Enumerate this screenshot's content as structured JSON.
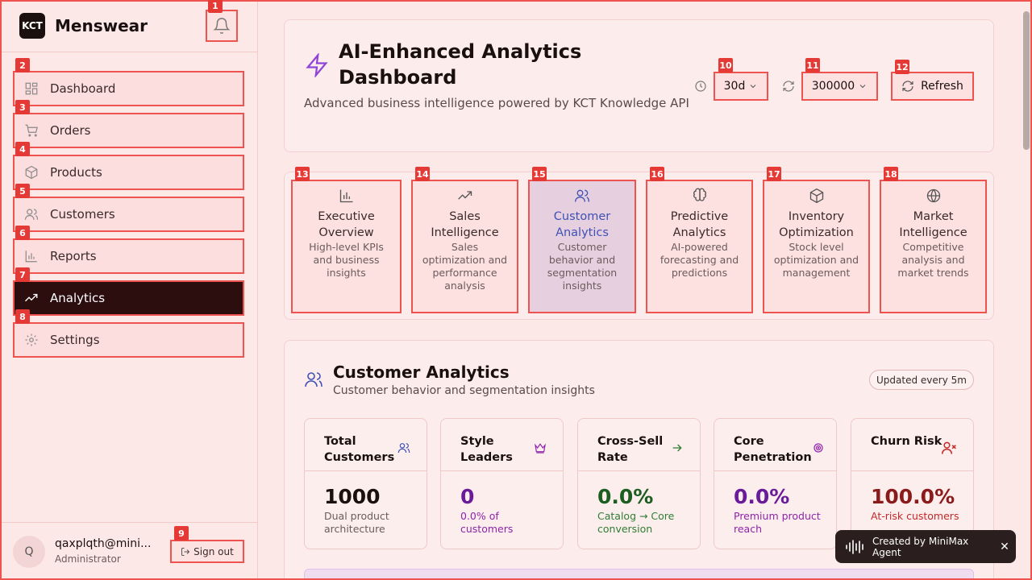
{
  "brand": {
    "logo": "KCT",
    "name": "Menswear"
  },
  "sidebar": {
    "items": [
      {
        "label": "Dashboard",
        "icon": "dashboard-icon",
        "badge": "2"
      },
      {
        "label": "Orders",
        "icon": "cart-icon",
        "badge": "3"
      },
      {
        "label": "Products",
        "icon": "box-icon",
        "badge": "4"
      },
      {
        "label": "Customers",
        "icon": "users-icon",
        "badge": "5"
      },
      {
        "label": "Reports",
        "icon": "bar-chart-icon",
        "badge": "6"
      },
      {
        "label": "Analytics",
        "icon": "trending-icon",
        "badge": "7",
        "active": true
      },
      {
        "label": "Settings",
        "icon": "gear-icon",
        "badge": "8"
      }
    ],
    "bell_badge": "1"
  },
  "user": {
    "initial": "Q",
    "email": "qaxplqth@mini...",
    "role": "Administrator"
  },
  "signout": {
    "label": "Sign out",
    "badge": "9"
  },
  "header": {
    "title": "AI-Enhanced Analytics Dashboard",
    "subtitle": "Advanced business intelligence powered by KCT Knowledge API",
    "range": {
      "value": "30d",
      "badge": "10"
    },
    "refresh_interval": {
      "value": "300000",
      "badge": "11"
    },
    "refresh": {
      "label": "Refresh",
      "badge": "12"
    }
  },
  "tabs": [
    {
      "title": "Executive Overview",
      "desc": "High-level KPIs and business insights",
      "badge": "13"
    },
    {
      "title": "Sales Intelligence",
      "desc": "Sales optimization and performance analysis",
      "badge": "14"
    },
    {
      "title": "Customer Analytics",
      "desc": "Customer behavior and segmentation insights",
      "badge": "15",
      "active": true
    },
    {
      "title": "Predictive Analytics",
      "desc": "AI-powered forecasting and predictions",
      "badge": "16"
    },
    {
      "title": "Inventory Optimization",
      "desc": "Stock level optimization and management",
      "badge": "17"
    },
    {
      "title": "Market Intelligence",
      "desc": "Competitive analysis and market trends",
      "badge": "18"
    }
  ],
  "section": {
    "title": "Customer Analytics",
    "subtitle": "Customer behavior and segmentation insights",
    "updated": "Updated every 5m"
  },
  "metrics": [
    {
      "title": "Total Customers",
      "value": "1000",
      "note": "Dual product architecture",
      "color": "#1a1010",
      "note_color": "#6b5b5b",
      "icon": "users-icon"
    },
    {
      "title": "Style Leaders",
      "value": "0",
      "note": "0.0% of customers",
      "color": "#6a1b9a",
      "note_color": "#8e24aa",
      "icon": "crown-icon"
    },
    {
      "title": "Cross-Sell Rate",
      "value": "0.0%",
      "note": "Catalog → Core conversion",
      "color": "#1b5e20",
      "note_color": "#2e7d32",
      "icon": "arrow-right-icon"
    },
    {
      "title": "Core Penetration",
      "value": "0.0%",
      "note": "Premium product reach",
      "color": "#6a1b9a",
      "note_color": "#8e24aa",
      "icon": "target-icon"
    },
    {
      "title": "Churn Risk",
      "value": "100.0%",
      "note": "At-risk customers",
      "color": "#8b1a1a",
      "note_color": "#c62828",
      "icon": "user-x-icon"
    }
  ],
  "toast": {
    "label": "Created by MiniMax Agent"
  },
  "colors": {
    "accent": "#ef5350",
    "active_nav": "#2d0e0e",
    "active_tab_text": "#3f51b5"
  }
}
